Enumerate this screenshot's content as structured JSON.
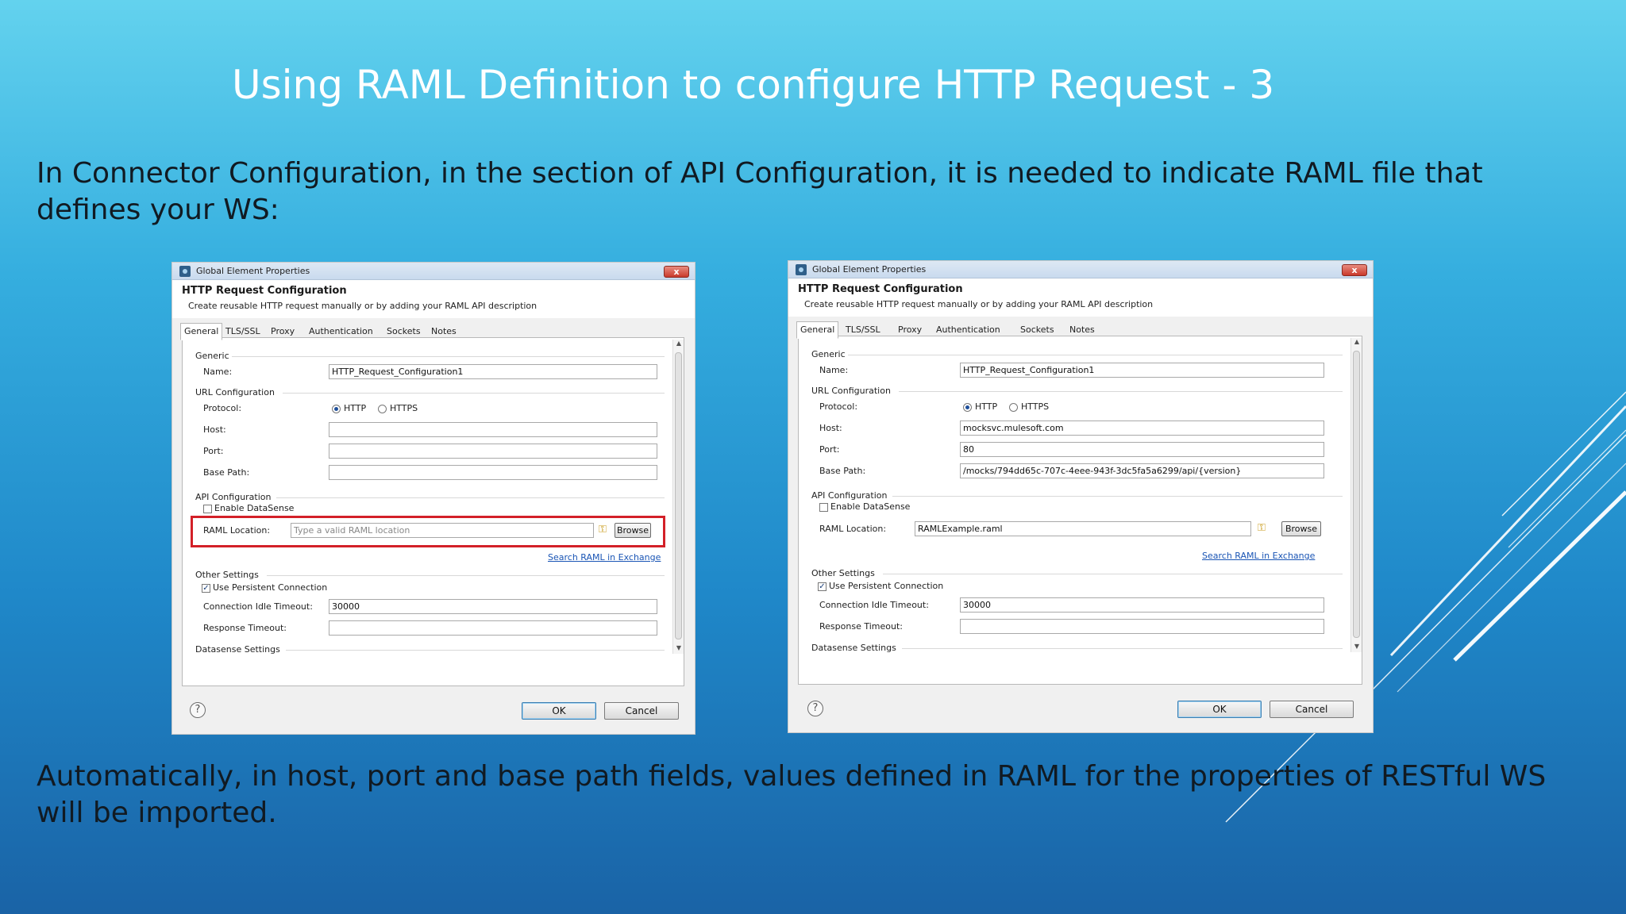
{
  "slide": {
    "title": "Using RAML Definition to configure HTTP Request - 3",
    "intro": "In Connector Configuration, in the section of API Configuration, it is needed to indicate RAML file that defines your WS:",
    "outro": "Automatically, in host, port and base path fields, values defined in RAML for the properties of RESTful WS will be imported."
  },
  "colors": {
    "highlight": "#d32028",
    "link": "#1a55b5",
    "title_text": "#ffffff"
  },
  "icons": {
    "window_close": "close-icon",
    "help": "help-icon",
    "key": "key-icon",
    "app": "app-icon"
  },
  "dialogs": [
    {
      "window_title": "Global Element Properties",
      "heading": "HTTP Request Configuration",
      "subheading": "Create reusable HTTP request manually or by adding your RAML API description",
      "tabs": [
        "General",
        "TLS/SSL",
        "Proxy",
        "Authentication",
        "Sockets",
        "Notes"
      ],
      "active_tab": "General",
      "generic_label": "Generic",
      "name_label": "Name:",
      "name_value": "HTTP_Request_Configuration1",
      "url_config_label": "URL Configuration",
      "protocol_label": "Protocol:",
      "protocol_options": [
        "HTTP",
        "HTTPS"
      ],
      "protocol_selected": "HTTP",
      "host_label": "Host:",
      "host_value": "",
      "port_label": "Port:",
      "port_value": "",
      "base_path_label": "Base Path:",
      "base_path_value": "",
      "api_config_label": "API Configuration",
      "datasense_label": "Enable DataSense",
      "datasense_checked": false,
      "raml_label": "RAML Location:",
      "raml_value": "",
      "raml_placeholder": "Type a valid RAML location",
      "raml_highlighted": true,
      "browse_label": "Browse",
      "exchange_link": "Search RAML in Exchange",
      "other_settings_label": "Other Settings",
      "persistent_label": "Use Persistent Connection",
      "persistent_checked": true,
      "idle_timeout_label": "Connection Idle Timeout:",
      "idle_timeout_value": "30000",
      "response_timeout_label": "Response Timeout:",
      "response_timeout_value": "",
      "datasense_settings_label": "Datasense Settings",
      "ok_label": "OK",
      "cancel_label": "Cancel",
      "help_symbol": "?",
      "close_symbol": "x"
    },
    {
      "window_title": "Global Element Properties",
      "heading": "HTTP Request Configuration",
      "subheading": "Create reusable HTTP request manually or by adding your RAML API description",
      "tabs": [
        "General",
        "TLS/SSL",
        "Proxy",
        "Authentication",
        "Sockets",
        "Notes"
      ],
      "active_tab": "General",
      "generic_label": "Generic",
      "name_label": "Name:",
      "name_value": "HTTP_Request_Configuration1",
      "url_config_label": "URL Configuration",
      "protocol_label": "Protocol:",
      "protocol_options": [
        "HTTP",
        "HTTPS"
      ],
      "protocol_selected": "HTTP",
      "host_label": "Host:",
      "host_value": "mocksvc.mulesoft.com",
      "port_label": "Port:",
      "port_value": "80",
      "base_path_label": "Base Path:",
      "base_path_value": "/mocks/794dd65c-707c-4eee-943f-3dc5fa5a6299/api/{version}",
      "api_config_label": "API Configuration",
      "datasense_label": "Enable DataSense",
      "datasense_checked": false,
      "raml_label": "RAML Location:",
      "raml_value": "RAMLExample.raml",
      "raml_placeholder": "",
      "raml_highlighted": false,
      "browse_label": "Browse",
      "exchange_link": "Search RAML in Exchange",
      "other_settings_label": "Other Settings",
      "persistent_label": "Use Persistent Connection",
      "persistent_checked": true,
      "idle_timeout_label": "Connection Idle Timeout:",
      "idle_timeout_value": "30000",
      "response_timeout_label": "Response Timeout:",
      "response_timeout_value": "",
      "datasense_settings_label": "Datasense Settings",
      "ok_label": "OK",
      "cancel_label": "Cancel",
      "help_symbol": "?",
      "close_symbol": "x"
    }
  ]
}
